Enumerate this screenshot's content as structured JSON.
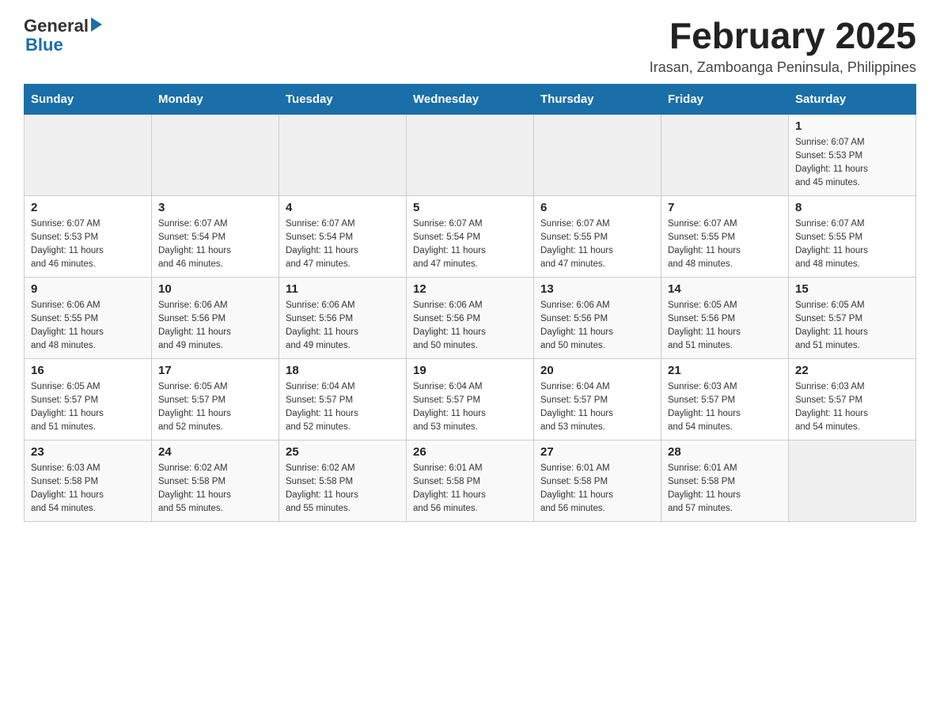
{
  "header": {
    "logo_general": "General",
    "logo_blue": "Blue",
    "title": "February 2025",
    "location": "Irasan, Zamboanga Peninsula, Philippines"
  },
  "days_of_week": [
    "Sunday",
    "Monday",
    "Tuesday",
    "Wednesday",
    "Thursday",
    "Friday",
    "Saturday"
  ],
  "weeks": [
    {
      "days": [
        {
          "number": "",
          "info": ""
        },
        {
          "number": "",
          "info": ""
        },
        {
          "number": "",
          "info": ""
        },
        {
          "number": "",
          "info": ""
        },
        {
          "number": "",
          "info": ""
        },
        {
          "number": "",
          "info": ""
        },
        {
          "number": "1",
          "info": "Sunrise: 6:07 AM\nSunset: 5:53 PM\nDaylight: 11 hours\nand 45 minutes."
        }
      ]
    },
    {
      "days": [
        {
          "number": "2",
          "info": "Sunrise: 6:07 AM\nSunset: 5:53 PM\nDaylight: 11 hours\nand 46 minutes."
        },
        {
          "number": "3",
          "info": "Sunrise: 6:07 AM\nSunset: 5:54 PM\nDaylight: 11 hours\nand 46 minutes."
        },
        {
          "number": "4",
          "info": "Sunrise: 6:07 AM\nSunset: 5:54 PM\nDaylight: 11 hours\nand 47 minutes."
        },
        {
          "number": "5",
          "info": "Sunrise: 6:07 AM\nSunset: 5:54 PM\nDaylight: 11 hours\nand 47 minutes."
        },
        {
          "number": "6",
          "info": "Sunrise: 6:07 AM\nSunset: 5:55 PM\nDaylight: 11 hours\nand 47 minutes."
        },
        {
          "number": "7",
          "info": "Sunrise: 6:07 AM\nSunset: 5:55 PM\nDaylight: 11 hours\nand 48 minutes."
        },
        {
          "number": "8",
          "info": "Sunrise: 6:07 AM\nSunset: 5:55 PM\nDaylight: 11 hours\nand 48 minutes."
        }
      ]
    },
    {
      "days": [
        {
          "number": "9",
          "info": "Sunrise: 6:06 AM\nSunset: 5:55 PM\nDaylight: 11 hours\nand 48 minutes."
        },
        {
          "number": "10",
          "info": "Sunrise: 6:06 AM\nSunset: 5:56 PM\nDaylight: 11 hours\nand 49 minutes."
        },
        {
          "number": "11",
          "info": "Sunrise: 6:06 AM\nSunset: 5:56 PM\nDaylight: 11 hours\nand 49 minutes."
        },
        {
          "number": "12",
          "info": "Sunrise: 6:06 AM\nSunset: 5:56 PM\nDaylight: 11 hours\nand 50 minutes."
        },
        {
          "number": "13",
          "info": "Sunrise: 6:06 AM\nSunset: 5:56 PM\nDaylight: 11 hours\nand 50 minutes."
        },
        {
          "number": "14",
          "info": "Sunrise: 6:05 AM\nSunset: 5:56 PM\nDaylight: 11 hours\nand 51 minutes."
        },
        {
          "number": "15",
          "info": "Sunrise: 6:05 AM\nSunset: 5:57 PM\nDaylight: 11 hours\nand 51 minutes."
        }
      ]
    },
    {
      "days": [
        {
          "number": "16",
          "info": "Sunrise: 6:05 AM\nSunset: 5:57 PM\nDaylight: 11 hours\nand 51 minutes."
        },
        {
          "number": "17",
          "info": "Sunrise: 6:05 AM\nSunset: 5:57 PM\nDaylight: 11 hours\nand 52 minutes."
        },
        {
          "number": "18",
          "info": "Sunrise: 6:04 AM\nSunset: 5:57 PM\nDaylight: 11 hours\nand 52 minutes."
        },
        {
          "number": "19",
          "info": "Sunrise: 6:04 AM\nSunset: 5:57 PM\nDaylight: 11 hours\nand 53 minutes."
        },
        {
          "number": "20",
          "info": "Sunrise: 6:04 AM\nSunset: 5:57 PM\nDaylight: 11 hours\nand 53 minutes."
        },
        {
          "number": "21",
          "info": "Sunrise: 6:03 AM\nSunset: 5:57 PM\nDaylight: 11 hours\nand 54 minutes."
        },
        {
          "number": "22",
          "info": "Sunrise: 6:03 AM\nSunset: 5:57 PM\nDaylight: 11 hours\nand 54 minutes."
        }
      ]
    },
    {
      "days": [
        {
          "number": "23",
          "info": "Sunrise: 6:03 AM\nSunset: 5:58 PM\nDaylight: 11 hours\nand 54 minutes."
        },
        {
          "number": "24",
          "info": "Sunrise: 6:02 AM\nSunset: 5:58 PM\nDaylight: 11 hours\nand 55 minutes."
        },
        {
          "number": "25",
          "info": "Sunrise: 6:02 AM\nSunset: 5:58 PM\nDaylight: 11 hours\nand 55 minutes."
        },
        {
          "number": "26",
          "info": "Sunrise: 6:01 AM\nSunset: 5:58 PM\nDaylight: 11 hours\nand 56 minutes."
        },
        {
          "number": "27",
          "info": "Sunrise: 6:01 AM\nSunset: 5:58 PM\nDaylight: 11 hours\nand 56 minutes."
        },
        {
          "number": "28",
          "info": "Sunrise: 6:01 AM\nSunset: 5:58 PM\nDaylight: 11 hours\nand 57 minutes."
        },
        {
          "number": "",
          "info": ""
        }
      ]
    }
  ],
  "colors": {
    "header_bg": "#1a6fa8",
    "header_text": "#ffffff",
    "accent_blue": "#1a6fa8"
  }
}
